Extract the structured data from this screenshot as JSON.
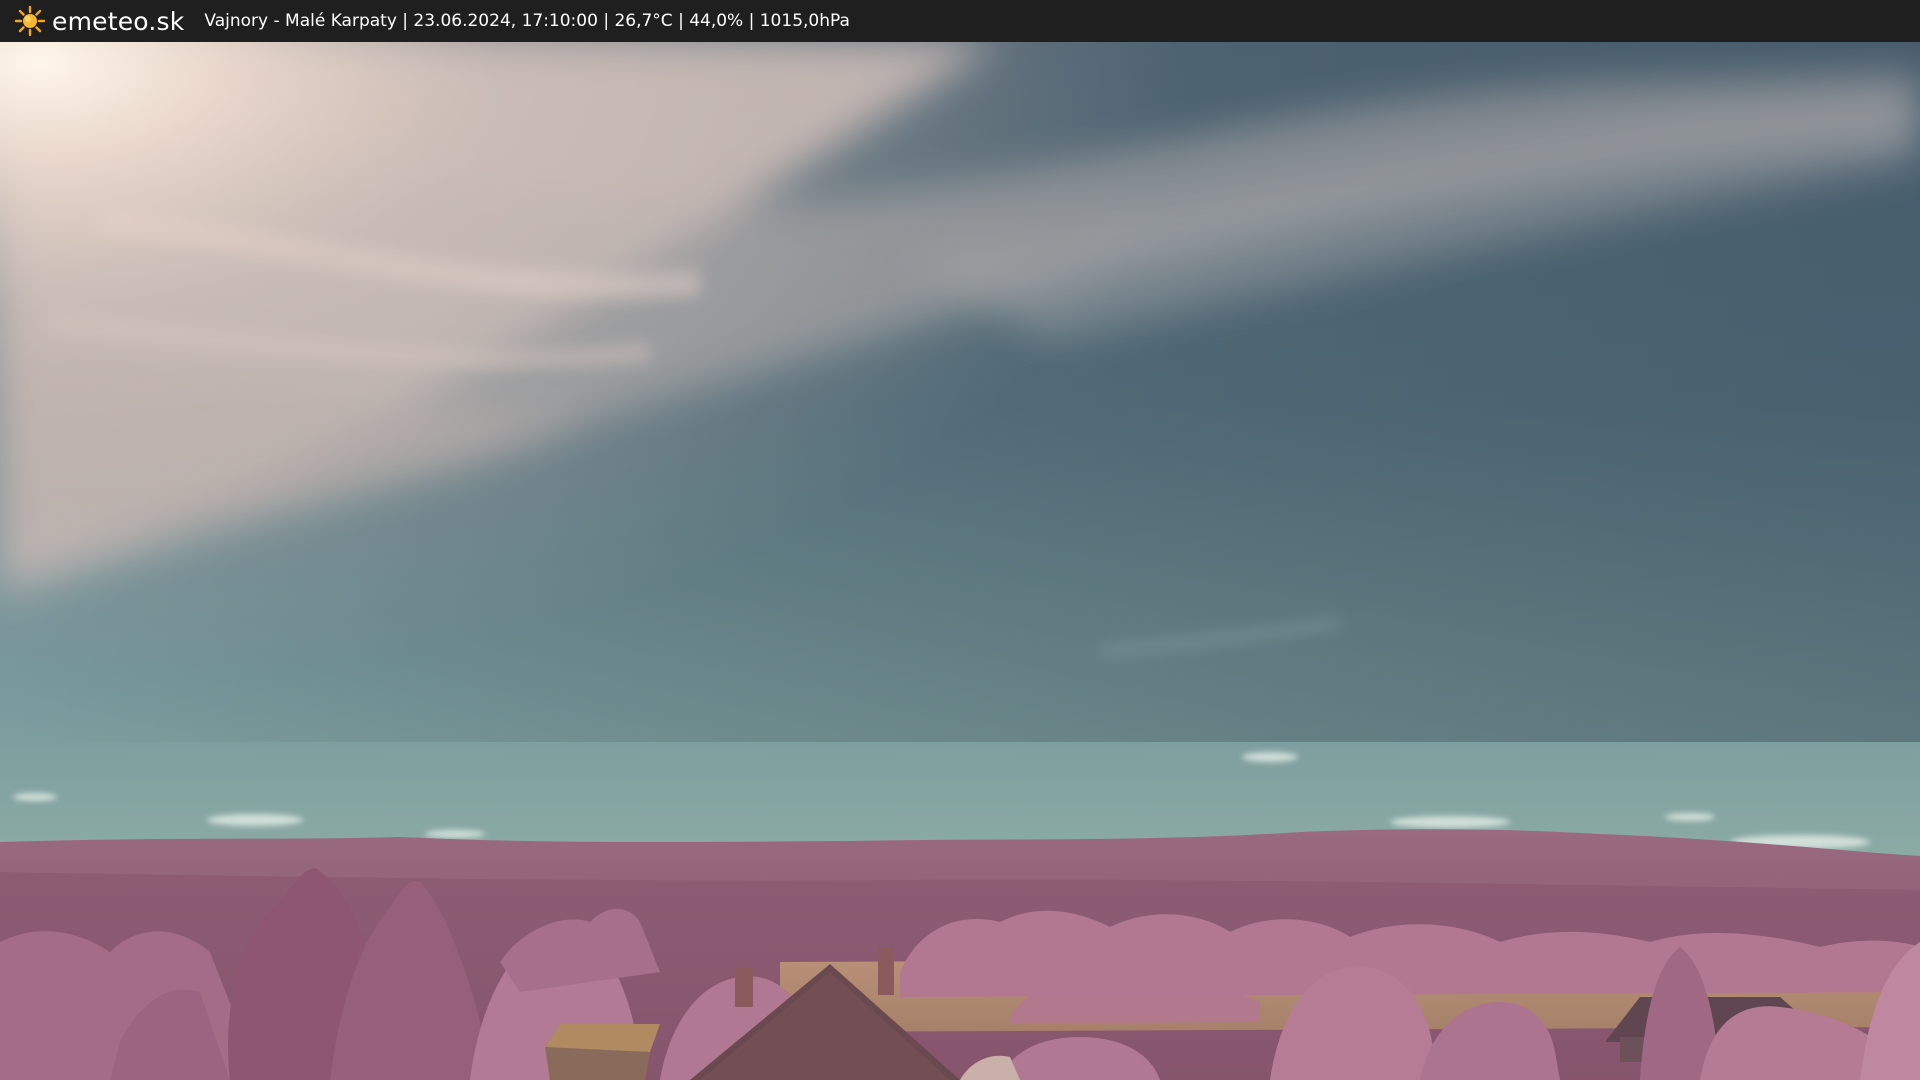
{
  "header": {
    "brand": "emeteo.sk",
    "caption": "Vajnory - Malé Karpaty | 23.06.2024, 17:10:00 | 26,7°C | 44,0% | 1015,0hPa"
  },
  "icons": {
    "logo": "sun-icon"
  },
  "colors": {
    "bar": "#1f1f1f",
    "sun": "#f5a623",
    "sky_top": "#4f6878",
    "sky_horizon": "#8fb0a8",
    "hills": "#8a5a70",
    "trees": "#b97a98",
    "field": "#b08a70"
  }
}
